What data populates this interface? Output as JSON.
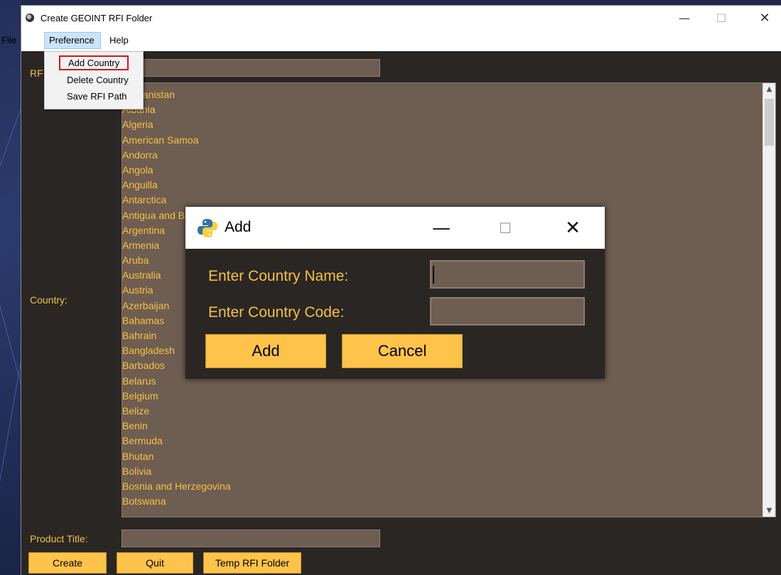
{
  "window": {
    "title": "Create GEOINT RFI Folder",
    "minimize": "—",
    "maximize": "☐",
    "close": "✕"
  },
  "menubar": {
    "file": "File",
    "preference": "Preference",
    "help": "Help"
  },
  "dropdown": {
    "add_country": "Add Country",
    "delete_country": "Delete Country",
    "save_rfi_path": "Save RFI Path"
  },
  "form": {
    "rfi_label": "RF",
    "country_label": "Country:",
    "product_title_label": "Product Title:",
    "create": "Create",
    "quit": "Quit",
    "temp_rfi_folder": "Temp RFI Folder"
  },
  "countries": [
    "Afghanistan",
    "Albania",
    "Algeria",
    "American Samoa",
    "Andorra",
    "Angola",
    "Anguilla",
    "Antarctica",
    "Antigua and Barbuda",
    "Argentina",
    "Armenia",
    "Aruba",
    "Australia",
    "Austria",
    "Azerbaijan",
    "Bahamas",
    "Bahrain",
    "Bangladesh",
    "Barbados",
    "Belarus",
    "Belgium",
    "Belize",
    "Benin",
    "Bermuda",
    "Bhutan",
    "Bolivia",
    "Bosnia and Herzegovina",
    "Botswana"
  ],
  "dialog": {
    "title": "Add",
    "minimize": "—",
    "maximize": "☐",
    "close": "✕",
    "name_label": "Enter Country Name:",
    "code_label": "Enter Country Code:",
    "add": "Add",
    "cancel": "Cancel"
  },
  "scrollbar": {
    "up": "▲",
    "down": "▼"
  },
  "colors": {
    "accent": "#f5c142",
    "button": "#fec34a",
    "list_bg": "#6e5d51",
    "window_bg": "#2a2624"
  }
}
